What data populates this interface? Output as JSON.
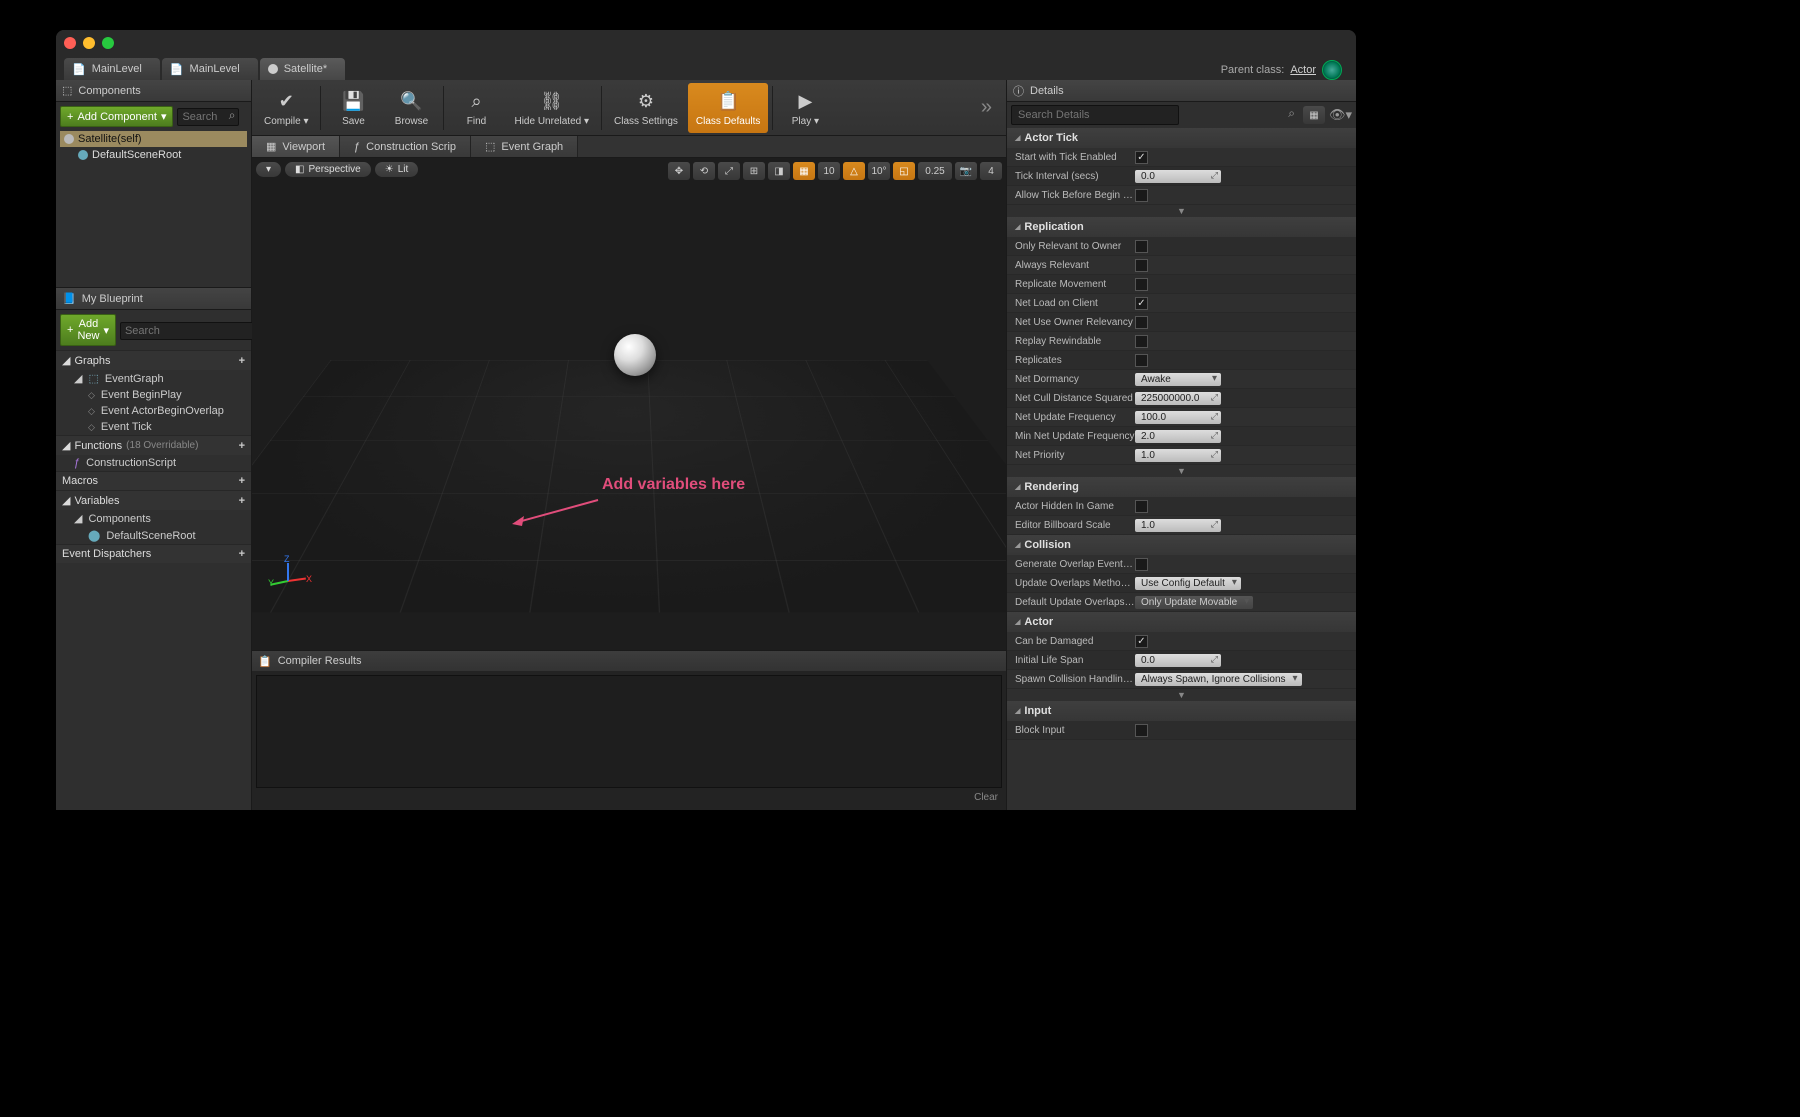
{
  "tabs": [
    {
      "label": "MainLevel"
    },
    {
      "label": "MainLevel"
    },
    {
      "label": "Satellite*"
    }
  ],
  "parent_class": {
    "label": "Parent class:",
    "value": "Actor"
  },
  "components_panel": {
    "title": "Components",
    "add_btn": "Add Component",
    "search_placeholder": "Search",
    "items": [
      {
        "label": "Satellite(self)",
        "selected": true
      },
      {
        "label": "DefaultSceneRoot",
        "indent": 1
      }
    ]
  },
  "my_blueprint": {
    "title": "My Blueprint",
    "add_btn": "Add New",
    "search_placeholder": "Search",
    "sections": {
      "graphs": {
        "title": "Graphs",
        "items": [
          {
            "label": "EventGraph",
            "children": [
              {
                "label": "Event BeginPlay"
              },
              {
                "label": "Event ActorBeginOverlap"
              },
              {
                "label": "Event Tick"
              }
            ]
          }
        ]
      },
      "functions": {
        "title": "Functions",
        "note": "(18 Overridable)",
        "items": [
          {
            "label": "ConstructionScript"
          }
        ]
      },
      "macros": {
        "title": "Macros"
      },
      "variables": {
        "title": "Variables",
        "items": [
          {
            "label": "Components",
            "children": [
              {
                "label": "DefaultSceneRoot"
              }
            ]
          }
        ]
      },
      "dispatchers": {
        "title": "Event Dispatchers"
      }
    }
  },
  "toolbar": [
    {
      "label": "Compile",
      "icon": "✔",
      "dd": true
    },
    {
      "label": "Save",
      "icon": "💾"
    },
    {
      "label": "Browse",
      "icon": "🔍"
    },
    {
      "label": "Find",
      "icon": "⌕"
    },
    {
      "label": "Hide Unrelated",
      "icon": "⛓",
      "dd": true
    },
    {
      "label": "Class Settings",
      "icon": "⚙"
    },
    {
      "label": "Class Defaults",
      "icon": "📋",
      "active": true
    },
    {
      "label": "Play",
      "icon": "▶",
      "dd": true
    }
  ],
  "sub_tabs": [
    {
      "label": "Viewport",
      "active": true
    },
    {
      "label": "Construction Scrip"
    },
    {
      "label": "Event Graph"
    }
  ],
  "viewport": {
    "mode_dropdown": "▾",
    "perspective": "Perspective",
    "lit": "Lit",
    "snap_translate": "10",
    "snap_rotate": "10°",
    "snap_scale": "0.25",
    "cam_speed": "4",
    "gizmo": {
      "x": "X",
      "y": "Y",
      "z": "Z"
    }
  },
  "annotation": "Add variables here",
  "compiler": {
    "title": "Compiler Results",
    "clear": "Clear"
  },
  "details": {
    "title": "Details",
    "search_placeholder": "Search Details",
    "categories": [
      {
        "name": "Actor Tick",
        "rows": [
          {
            "label": "Start with Tick Enabled",
            "type": "chk",
            "value": true
          },
          {
            "label": "Tick Interval (secs)",
            "type": "num",
            "value": "0.0"
          },
          {
            "label": "Allow Tick Before Begin Pla",
            "type": "chk",
            "value": false
          }
        ],
        "expand": true
      },
      {
        "name": "Replication",
        "rows": [
          {
            "label": "Only Relevant to Owner",
            "type": "chk",
            "value": false
          },
          {
            "label": "Always Relevant",
            "type": "chk",
            "value": false
          },
          {
            "label": "Replicate Movement",
            "type": "chk",
            "value": false
          },
          {
            "label": "Net Load on Client",
            "type": "chk",
            "value": true
          },
          {
            "label": "Net Use Owner Relevancy",
            "type": "chk",
            "value": false
          },
          {
            "label": "Replay Rewindable",
            "type": "chk",
            "value": false
          },
          {
            "label": "Replicates",
            "type": "chk",
            "value": false
          },
          {
            "label": "Net Dormancy",
            "type": "sel",
            "value": "Awake"
          },
          {
            "label": "Net Cull Distance Squared",
            "type": "num",
            "value": "225000000.0"
          },
          {
            "label": "Net Update Frequency",
            "type": "num",
            "value": "100.0"
          },
          {
            "label": "Min Net Update Frequency",
            "type": "num",
            "value": "2.0"
          },
          {
            "label": "Net Priority",
            "type": "num",
            "value": "1.0"
          }
        ],
        "expand": true
      },
      {
        "name": "Rendering",
        "rows": [
          {
            "label": "Actor Hidden In Game",
            "type": "chk",
            "value": false
          },
          {
            "label": "Editor Billboard Scale",
            "type": "num",
            "value": "1.0"
          }
        ]
      },
      {
        "name": "Collision",
        "rows": [
          {
            "label": "Generate Overlap Events D",
            "type": "chk",
            "value": false
          },
          {
            "label": "Update Overlaps Method D",
            "type": "sel",
            "value": "Use Config Default"
          },
          {
            "label": "Default Update Overlaps M",
            "type": "sel_dark",
            "value": "Only Update Movable"
          }
        ]
      },
      {
        "name": "Actor",
        "rows": [
          {
            "label": "Can be Damaged",
            "type": "chk",
            "value": true
          },
          {
            "label": "Initial Life Span",
            "type": "num",
            "value": "0.0"
          },
          {
            "label": "Spawn Collision Handling M",
            "type": "sel",
            "value": "Always Spawn, Ignore Collisions"
          }
        ],
        "expand": true
      },
      {
        "name": "Input",
        "rows": [
          {
            "label": "Block Input",
            "type": "chk",
            "value": false
          }
        ]
      }
    ]
  }
}
